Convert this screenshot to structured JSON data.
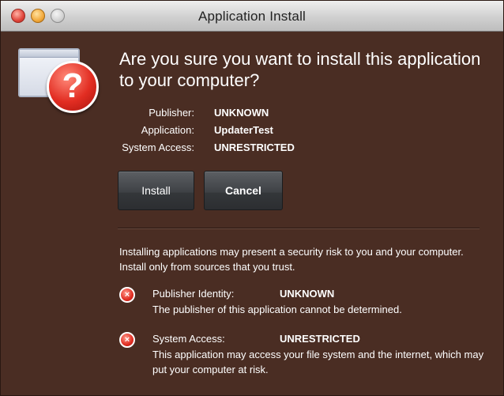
{
  "window": {
    "title": "Application Install"
  },
  "icons": {
    "app": "application-window-icon",
    "badge": "question-mark-icon",
    "badge_glyph": "?",
    "risk_glyph": "×"
  },
  "headline": "Are you sure you want to install this application to your computer?",
  "details": {
    "publisher_label": "Publisher:",
    "publisher_value": "UNKNOWN",
    "application_label": "Application:",
    "application_value": "UpdaterTest",
    "access_label": "System Access:",
    "access_value": "UNRESTRICTED"
  },
  "buttons": {
    "install_label": "Install",
    "cancel_label": "Cancel"
  },
  "warning": "Installing applications may present a security risk to you and your computer. Install only from sources that you trust.",
  "risks": [
    {
      "label": "Publisher Identity:",
      "value": "UNKNOWN",
      "description": "The publisher of this application cannot be determined."
    },
    {
      "label": "System Access:",
      "value": "UNRESTRICTED",
      "description": "This application may access your file system and the internet, which may put your computer at risk."
    }
  ],
  "colors": {
    "background": "#4a2d23",
    "text": "#ffffff",
    "alert_red": "#e22d22"
  }
}
